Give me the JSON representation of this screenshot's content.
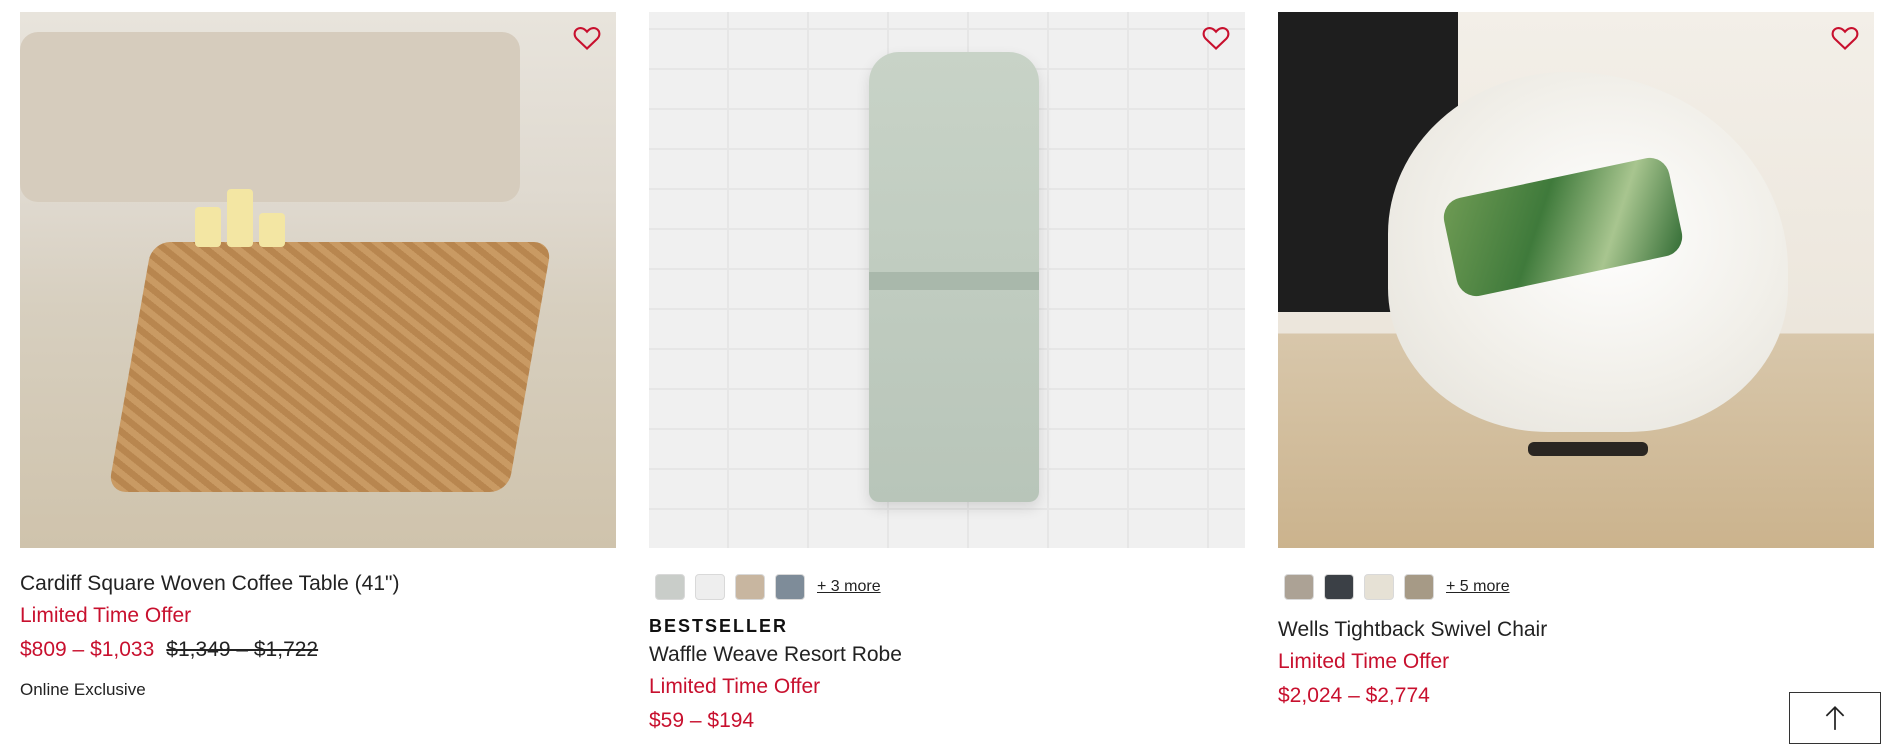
{
  "colors": {
    "sale_red": "#c8102e",
    "text": "#222222",
    "heart_outline": "#c8102e"
  },
  "products": [
    {
      "name": "Cardiff Square Woven Coffee Table (41\")",
      "offer": "Limited Time Offer",
      "price_now": "$809 – $1,033",
      "price_was": "$1,349 – $1,722",
      "note": "Online Exclusive",
      "favorite_icon": "heart-outline-icon"
    },
    {
      "badge": "BESTSELLER",
      "name": "Waffle Weave Resort Robe",
      "offer": "Limited Time Offer",
      "price_now": "$59 – $194",
      "favorite_icon": "heart-outline-icon",
      "swatches": [
        "#c9cdc9",
        "#eeeeee",
        "#c8b6a0",
        "#7e8c99"
      ],
      "more_label": "+ 3 more"
    },
    {
      "name": "Wells Tightback Swivel Chair",
      "offer": "Limited Time Offer",
      "price_now": "$2,024 – $2,774",
      "favorite_icon": "heart-outline-icon",
      "swatches": [
        "#aca295",
        "#3b4046",
        "#e6e1d5",
        "#a69a86"
      ],
      "more_label": "+ 5 more"
    }
  ],
  "back_to_top_icon": "arrow-up-icon"
}
